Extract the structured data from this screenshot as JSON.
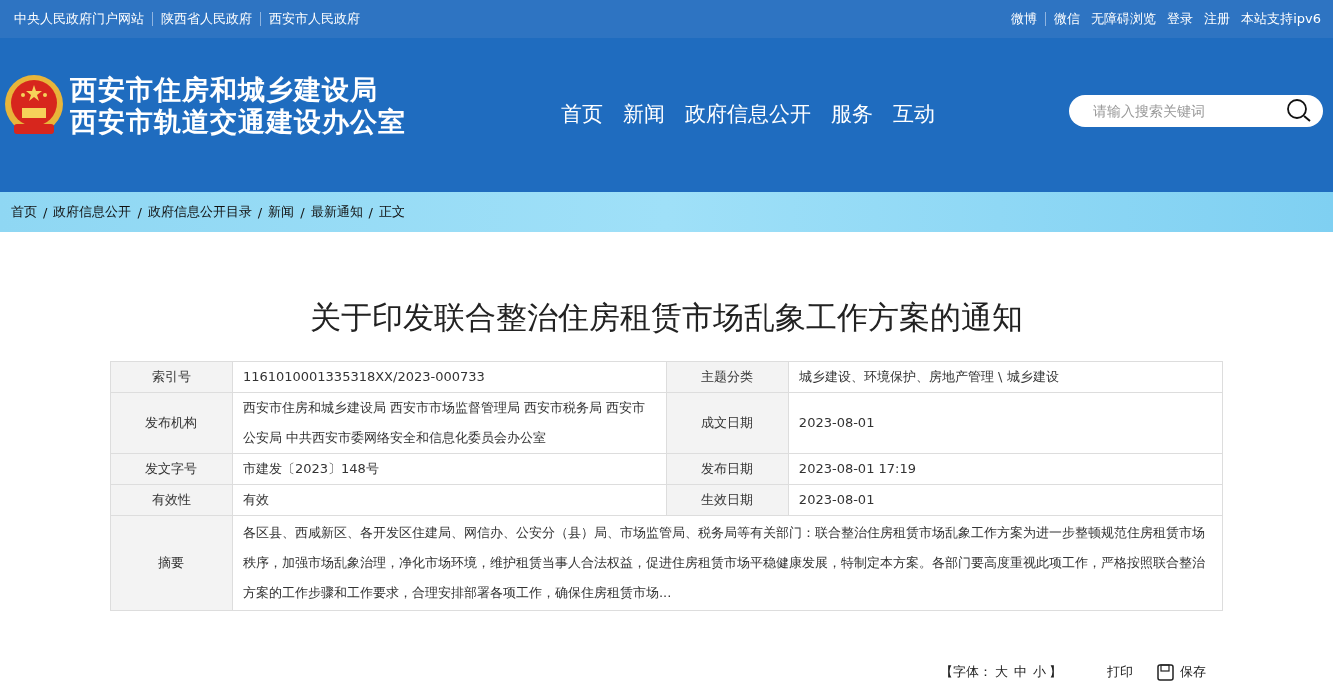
{
  "top_bar": {
    "left_links": [
      "中央人民政府门户网站",
      "陕西省人民政府",
      "西安市人民政府"
    ],
    "right_links": [
      "微博",
      "微信",
      "无障碍浏览",
      "登录",
      "注册",
      "本站支持ipv6"
    ]
  },
  "header": {
    "title_lines": [
      "西安市住房和城乡建设局",
      "西安市轨道交通建设办公室"
    ],
    "nav": [
      "首页",
      "新闻",
      "政府信息公开",
      "服务",
      "互动"
    ],
    "search": {
      "placeholder": "请输入搜索关键词"
    }
  },
  "breadcrumb": [
    {
      "label": "首页"
    },
    {
      "separator": "/",
      "label": "政府信息公开"
    },
    {
      "separator": "/",
      "label": "政府信息公开目录"
    },
    {
      "separator": "/",
      "label": "新闻"
    },
    {
      "separator": "/",
      "label": "最新通知"
    },
    {
      "separator": "/",
      "label": "正文"
    }
  ],
  "article": {
    "title": "关于印发联合整治住房租赁市场乱象工作方案的通知",
    "info_rows": [
      {
        "cells": [
          {
            "label": "索引号",
            "value": "1161010001335318XX/2023-000733"
          },
          {
            "label": "主题分类",
            "value": "城乡建设、环境保护、房地产管理 \\ 城乡建设"
          }
        ]
      },
      {
        "cells": [
          {
            "label": "发布机构",
            "value": "西安市住房和城乡建设局 西安市市场监督管理局 西安市税务局 西安市公安局 中共西安市委网络安全和信息化委员会办公室"
          },
          {
            "label": "成文日期",
            "value": "2023-08-01"
          }
        ]
      },
      {
        "cells": [
          {
            "label": "发文字号",
            "value": "市建发〔2023〕148号"
          },
          {
            "label": "发布日期",
            "value": "2023-08-01 17:19"
          }
        ]
      },
      {
        "cells": [
          {
            "label": "有效性",
            "value": "有效"
          },
          {
            "label": "生效日期",
            "value": "2023-08-01"
          }
        ]
      }
    ],
    "abstract": {
      "label": "摘要",
      "value": "各区县、西咸新区、各开发区住建局、网信办、公安分（县）局、市场监管局、税务局等有关部门：联合整治住房租赁市场乱象工作方案为进一步整顿规范住房租赁市场秩序，加强市场乱象治理，净化市场环境，维护租赁当事人合法权益，促进住房租赁市场平稳健康发展，特制定本方案。各部门要高度重视此项工作，严格按照联合整治方案的工作步骤和工作要求，合理安排部署各项工作，确保住房租赁市场..."
    },
    "tools": {
      "font_prefix": "【字体：",
      "font_sizes": [
        "大",
        "中",
        "小"
      ],
      "font_suffix": "】",
      "print": "打印",
      "save": "保存"
    }
  }
}
